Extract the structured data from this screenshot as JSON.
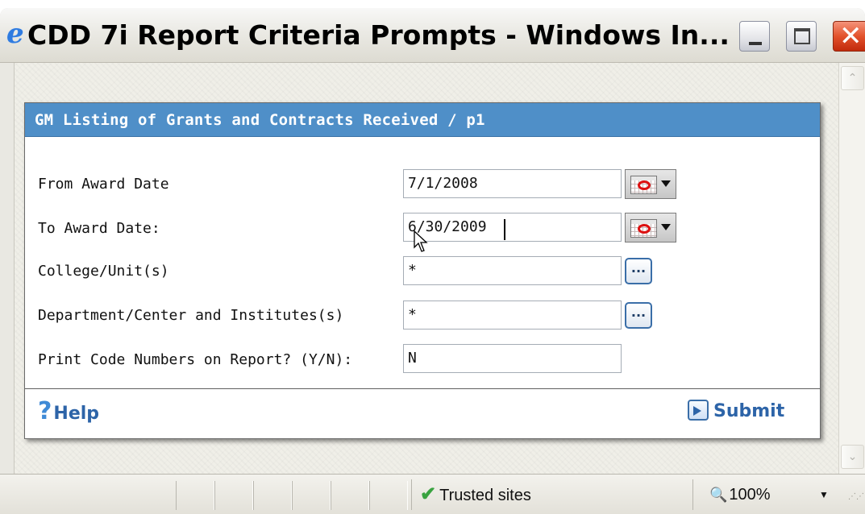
{
  "window": {
    "title": "CDD 7i Report Criteria Prompts - Windows In..."
  },
  "dialog": {
    "header": "GM Listing of Grants and Contracts Received / p1",
    "fields": [
      {
        "label": "From Award Date",
        "value": "7/1/2008"
      },
      {
        "label": "To Award Date:",
        "value": "6/30/2009"
      },
      {
        "label": "College/Unit(s)",
        "value": "*"
      },
      {
        "label": "Department/Center and Institutes(s)",
        "value": "*"
      },
      {
        "label": "Print Code Numbers on Report? (Y/N):",
        "value": "N"
      }
    ],
    "lookup_label": "...",
    "help_label": "Help",
    "submit_label": "Submit"
  },
  "statusbar": {
    "zone": "Trusted sites",
    "zoom": "100%"
  },
  "icons": {
    "app": "ie-icon",
    "date_picker": "calendar-icon",
    "help": "question-mark-icon",
    "submit": "submit-arrow-icon",
    "zone": "checkmark-icon",
    "zoom": "magnifier-icon"
  },
  "colors": {
    "dialog_header_bg": "#4f8fc8",
    "link_text": "#2d64a8",
    "close_button": "#e3522c"
  }
}
